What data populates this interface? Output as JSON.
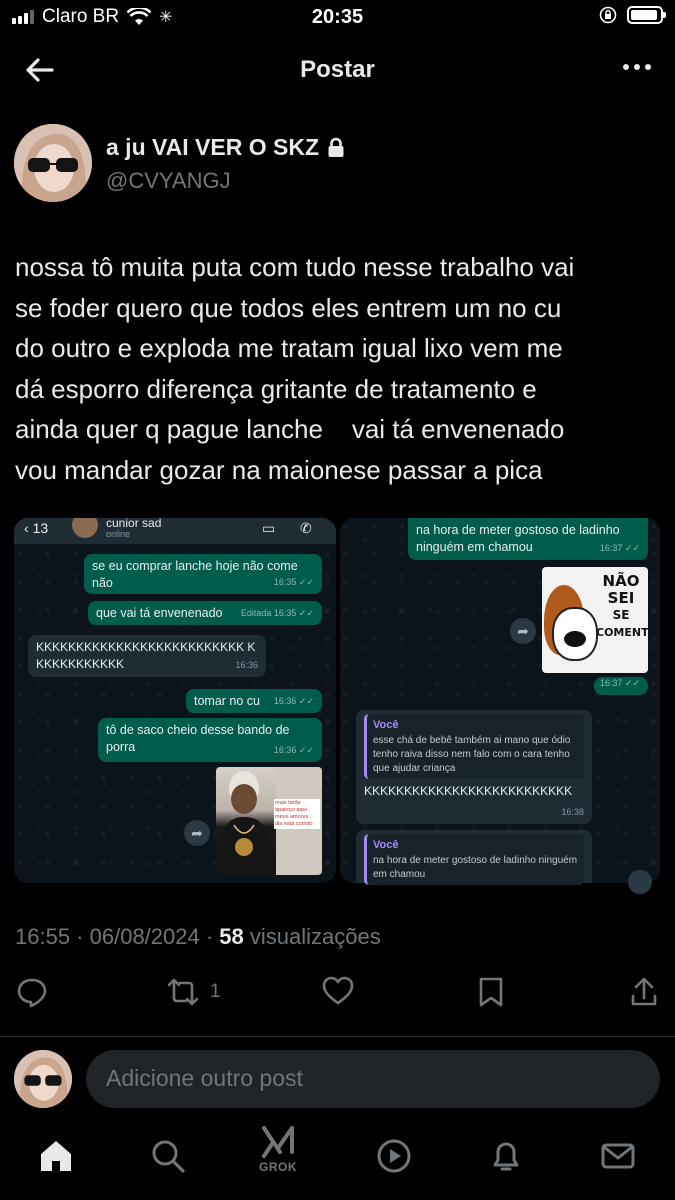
{
  "status_bar": {
    "carrier": "Claro BR",
    "time": "20:35"
  },
  "header": {
    "title": "Postar"
  },
  "author": {
    "name": "a ju VAI VER O SKZ",
    "handle": "@CVYANGJ"
  },
  "post": {
    "text": "nossa tô muita puta com tudo nesse trabalho vai\nse foder quero que todos eles entrem um no cu\ndo outro e exploda me tratam igual lixo vem me\ndá esporro diferença gritante de tratamento e\nainda quer q pague lanche    vai tá envenenado\nvou mandar gozar na maionese passar a pica"
  },
  "media_left": {
    "back_count": "13",
    "contact": "cunior sad",
    "contact_status": "online",
    "messages": [
      {
        "text": "se eu comprar lanche hoje não come não",
        "time": "16:35 ✓✓"
      },
      {
        "text": "que vai tá envenenado",
        "edited": "Editada",
        "time": "16:35 ✓✓"
      },
      {
        "text": "KKKKKKKKKKKKKKKKKKKKKKKKKK KKKKKKKKKKKK",
        "time": "16:36"
      },
      {
        "text": "tomar no cu",
        "time": "16:36 ✓✓"
      },
      {
        "text": "tô de saco cheio desse bando de porra",
        "time": "16:36 ✓✓"
      }
    ],
    "photo_caption": "mais tarde apareço aqui meus amores , dia está corrido"
  },
  "media_right": {
    "messages": [
      {
        "text": "na hora de meter gostoso de ladinho ninguém em chamou",
        "time": "16:37 ✓✓"
      },
      {
        "quote_author": "Você",
        "quote_text": "esse chá de bebê também ai mano que ódio tenho raiva disso nem falo com o cara tenho que ajudar criança",
        "text": "KKKKKKKKKKKKKKKKKKKKKKKKKK",
        "time": "16:38"
      },
      {
        "quote_author": "Você",
        "quote_text": "na hora de meter gostoso de ladinho ninguém em chamou"
      }
    ],
    "sticker_time": "16:37 ✓✓",
    "sticker_text": [
      "NÃO",
      "SEI",
      "SE",
      "COMENTO"
    ]
  },
  "meta": {
    "time": "16:55",
    "date": "06/08/2024",
    "views": "58",
    "views_label": "visualizações"
  },
  "actions": {
    "reposts": "1"
  },
  "reply": {
    "placeholder": "Adicione outro post"
  },
  "nav": {
    "grok_label": "GROK"
  },
  "colors": {
    "background": "#000000",
    "text": "#e7e9ea",
    "muted": "#71767b",
    "wa_out": "#005c4b",
    "wa_in": "#1f2c34"
  }
}
